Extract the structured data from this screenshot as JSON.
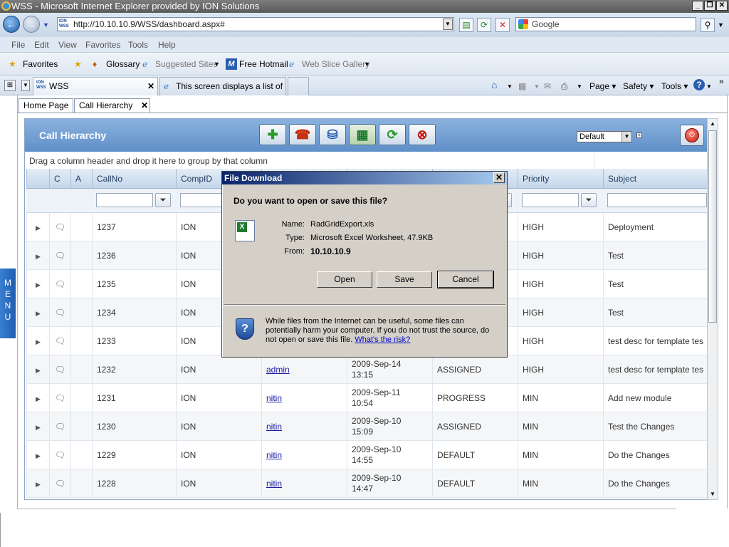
{
  "window": {
    "title": "WSS - Microsoft Internet Explorer provided by ION Solutions"
  },
  "nav": {
    "url": "http://10.10.10.9/WSS/dashboard.aspx#",
    "search_placeholder": "Google",
    "url_favicon": "ION WSS"
  },
  "menu": [
    "File",
    "Edit",
    "View",
    "Favorites",
    "Tools",
    "Help"
  ],
  "favorites": {
    "label": "Favorites",
    "items": [
      "Glossary",
      "Suggested Sites",
      "Free Hotmail",
      "Web Slice Gallery"
    ]
  },
  "browser_tabs": [
    {
      "label": "WSS"
    },
    {
      "label": "This screen displays a list of ..."
    }
  ],
  "commands": [
    "Page",
    "Safety",
    "Tools"
  ],
  "page_tabs": [
    {
      "label": "Home Page"
    },
    {
      "label": "Call Hierarchy"
    }
  ],
  "side_menu": "MENU",
  "panel": {
    "title": "Call Hierarchy",
    "view_select": "Default",
    "group_hint": "Drag a column header and drop it here to group by that column"
  },
  "columns": [
    "C",
    "A",
    "CallNo",
    "CompID",
    "Priority",
    "Subject"
  ],
  "rows": [
    {
      "callno": "1237",
      "compid": "ION",
      "user": "",
      "date": "",
      "time": "",
      "status": "",
      "priority": "HIGH",
      "subject": "Deployment"
    },
    {
      "callno": "1236",
      "compid": "ION",
      "user": "",
      "date": "",
      "time": "",
      "status": "",
      "priority": "HIGH",
      "subject": "Test"
    },
    {
      "callno": "1235",
      "compid": "ION",
      "user": "",
      "date": "",
      "time": "",
      "status": "",
      "priority": "HIGH",
      "subject": "Test"
    },
    {
      "callno": "1234",
      "compid": "ION",
      "user": "",
      "date": "",
      "time": "",
      "status": "",
      "priority": "HIGH",
      "subject": "Test"
    },
    {
      "callno": "1233",
      "compid": "ION",
      "user": "",
      "date": "",
      "time": "",
      "status": "",
      "priority": "HIGH",
      "subject": "test desc for template tes"
    },
    {
      "callno": "1232",
      "compid": "ION",
      "user": "admin",
      "date": "2009-Sep-14",
      "time": "13:15",
      "status": "ASSIGNED",
      "priority": "HIGH",
      "subject": "test desc for template tes"
    },
    {
      "callno": "1231",
      "compid": "ION",
      "user": "nitin",
      "date": "2009-Sep-11",
      "time": "10:54",
      "status": "PROGRESS",
      "priority": "MIN",
      "subject": "Add new module"
    },
    {
      "callno": "1230",
      "compid": "ION",
      "user": "nitin",
      "date": "2009-Sep-10",
      "time": "15:09",
      "status": "ASSIGNED",
      "priority": "MIN",
      "subject": "Test the Changes"
    },
    {
      "callno": "1229",
      "compid": "ION",
      "user": "nitin",
      "date": "2009-Sep-10",
      "time": "14:55",
      "status": "DEFAULT",
      "priority": "MIN",
      "subject": "Do the Changes"
    },
    {
      "callno": "1228",
      "compid": "ION",
      "user": "nitin",
      "date": "2009-Sep-10",
      "time": "14:47",
      "status": "DEFAULT",
      "priority": "MIN",
      "subject": "Do the Changes"
    }
  ],
  "dialog": {
    "title": "File Download",
    "question": "Do you want to open or save this file?",
    "name_label": "Name:",
    "name": "RadGridExport.xls",
    "type_label": "Type:",
    "type": "Microsoft Excel Worksheet, 47.9KB",
    "from_label": "From:",
    "from": "10.10.10.9",
    "open": "Open",
    "save": "Save",
    "cancel": "Cancel",
    "warning": "While files from the Internet can be useful, some files can potentially harm your computer. If you do not trust the source, do not open or save this file.",
    "risk_link": "What's the risk?"
  }
}
